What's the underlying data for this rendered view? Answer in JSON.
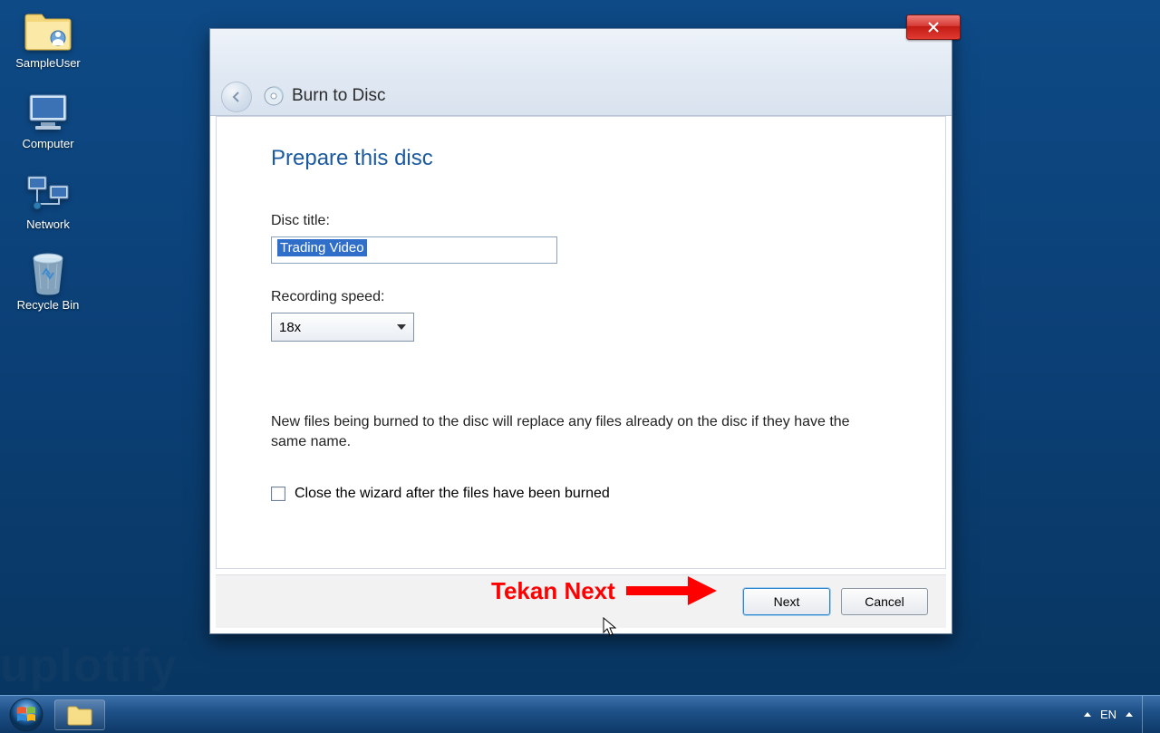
{
  "desktop": {
    "icons": [
      {
        "label": "SampleUser"
      },
      {
        "label": "Computer"
      },
      {
        "label": "Network"
      },
      {
        "label": "Recycle Bin"
      }
    ]
  },
  "dialog": {
    "window_title": "Burn to Disc",
    "heading": "Prepare this disc",
    "labels": {
      "disc_title": "Disc title:",
      "recording_speed": "Recording speed:"
    },
    "fields": {
      "disc_title_value": "Trading Video",
      "recording_speed_value": "18x"
    },
    "info_text": "New files being burned to the disc will replace any files already on the disc if they have the same name.",
    "checkbox_label": "Close the wizard after the files have been burned",
    "checkbox_checked": false,
    "buttons": {
      "next": "Next",
      "cancel": "Cancel"
    }
  },
  "annotation": {
    "text": "Tekan Next"
  },
  "watermark": "uplotify",
  "taskbar": {
    "lang": "EN"
  }
}
